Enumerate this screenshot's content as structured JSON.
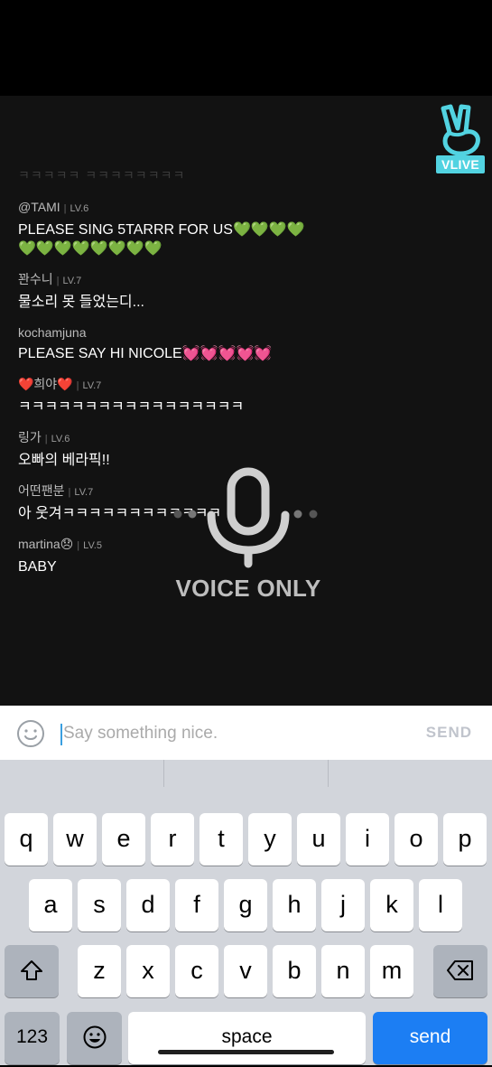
{
  "brand": {
    "logo_text": "VLIVE",
    "accent": "#52d3e1"
  },
  "chat": {
    "faded_line": "ㅋㅋㅋㅋㅋ ㅋㅋㅋㅋㅋㅋㅋㅋ",
    "messages": [
      {
        "user": "@TAMI",
        "level": "LV.6",
        "text": "PLEASE SING 5TARRR FOR US💚💚💚💚💚💚💚💚💚💚💚💚"
      },
      {
        "user": "꽌수니",
        "level": "LV.7",
        "text": "물소리 못 들었는디..."
      },
      {
        "user": "kochamjuna",
        "level": "",
        "text": "PLEASE SAY HI NICOLE💓💓💓💓💓"
      },
      {
        "user": "❤️희야❤️",
        "level": "LV.7",
        "text": "ㅋㅋㅋㅋㅋㅋㅋㅋㅋㅋㅋㅋㅋㅋㅋㅋㅋ"
      },
      {
        "user": "링가",
        "level": "LV.6",
        "text": "오빠의 베라픽!!"
      },
      {
        "user": "어떤팬분",
        "level": "LV.7",
        "text": "아 웃겨ㅋㅋㅋㅋㅋㅋㅋㅋㅋㅋㅋㅋ"
      },
      {
        "user": "martina😞",
        "level": "LV.5",
        "text": "BABY"
      }
    ]
  },
  "voice": {
    "label": "VOICE ONLY",
    "icon": "microphone-icon"
  },
  "input": {
    "placeholder": "Say something nice.",
    "value": "",
    "send_label": "SEND",
    "emoji_icon": "smiley-icon"
  },
  "keyboard": {
    "row1": [
      "q",
      "w",
      "e",
      "r",
      "t",
      "y",
      "u",
      "i",
      "o",
      "p"
    ],
    "row2": [
      "a",
      "s",
      "d",
      "f",
      "g",
      "h",
      "j",
      "k",
      "l"
    ],
    "row3": [
      "z",
      "x",
      "c",
      "v",
      "b",
      "n",
      "m"
    ],
    "shift_icon": "shift-icon",
    "backspace_icon": "backspace-icon",
    "numbers_label": "123",
    "emoji_key_icon": "emoji-icon",
    "space_label": "space",
    "send_label": "send"
  }
}
